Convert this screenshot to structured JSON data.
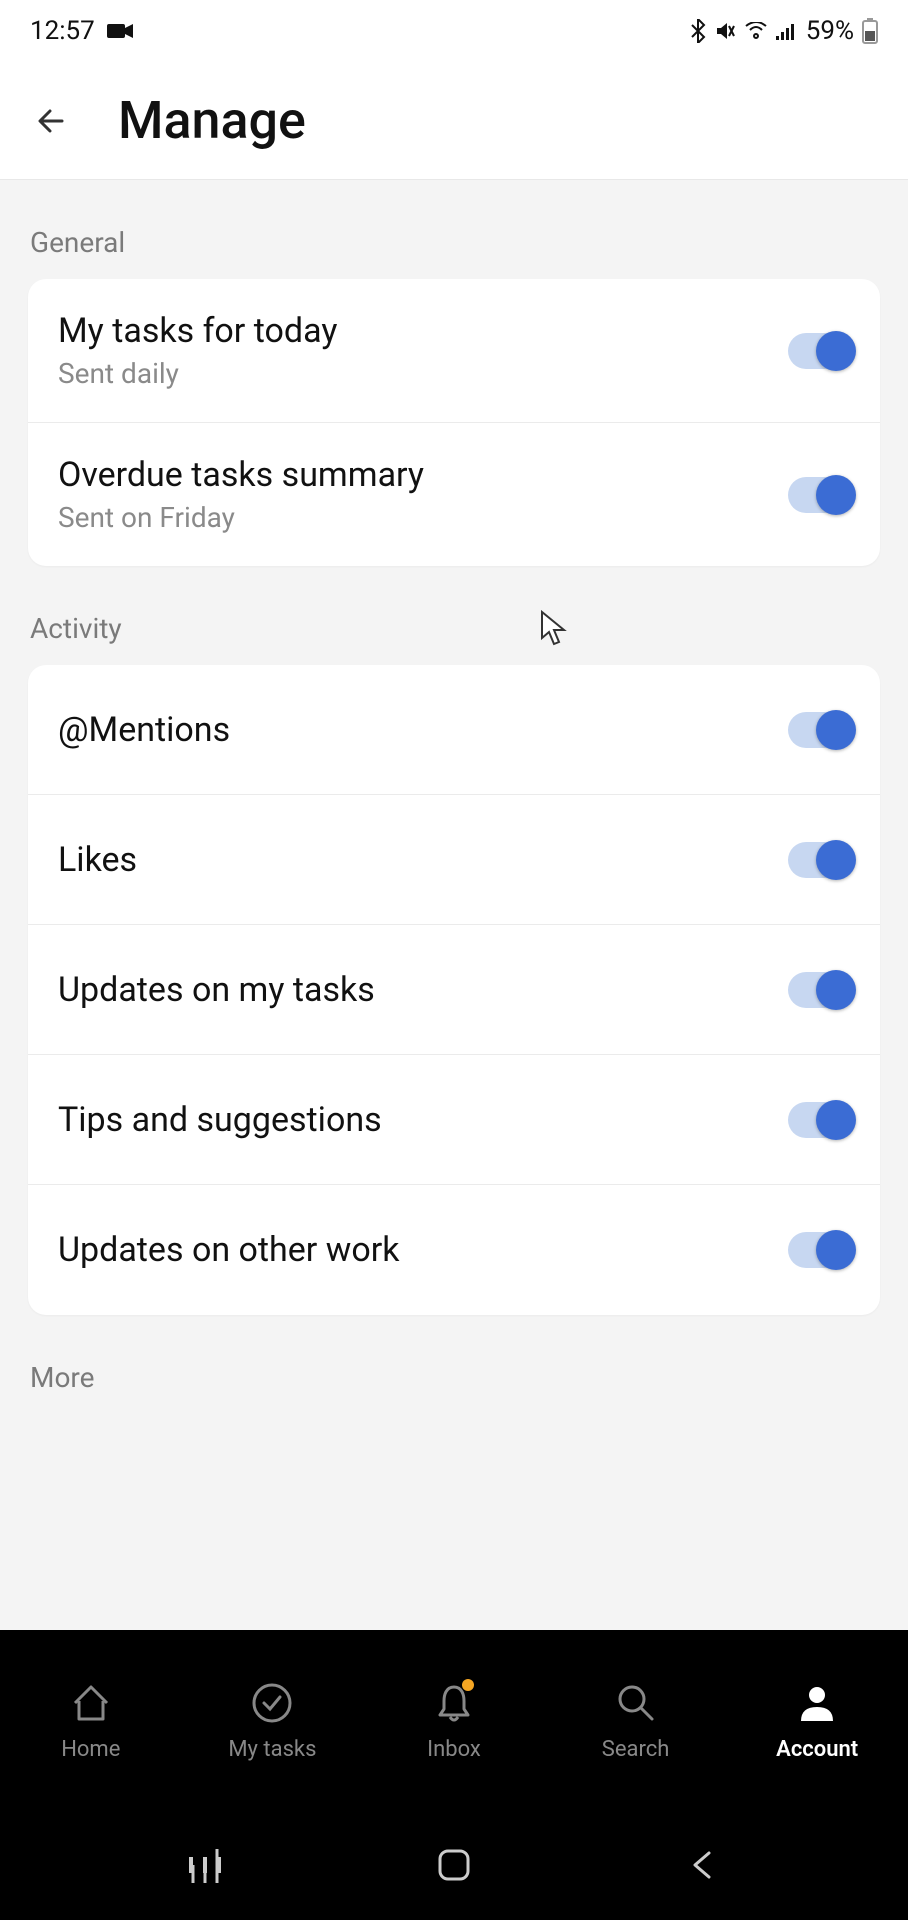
{
  "status": {
    "time": "12:57",
    "battery": "59%"
  },
  "header": {
    "title": "Manage"
  },
  "sections": {
    "general": {
      "label": "General",
      "items": [
        {
          "title": "My tasks for today",
          "sub": "Sent daily",
          "on": true
        },
        {
          "title": "Overdue tasks summary",
          "sub": "Sent on Friday",
          "on": true
        }
      ]
    },
    "activity": {
      "label": "Activity",
      "items": [
        {
          "title": "@Mentions",
          "on": true
        },
        {
          "title": "Likes",
          "on": true
        },
        {
          "title": "Updates on my tasks",
          "on": true
        },
        {
          "title": "Tips and suggestions",
          "on": true
        },
        {
          "title": "Updates on other work",
          "on": true
        }
      ]
    },
    "more": {
      "label": "More"
    }
  },
  "nav": {
    "items": [
      {
        "label": "Home"
      },
      {
        "label": "My tasks"
      },
      {
        "label": "Inbox"
      },
      {
        "label": "Search"
      },
      {
        "label": "Account"
      }
    ]
  }
}
